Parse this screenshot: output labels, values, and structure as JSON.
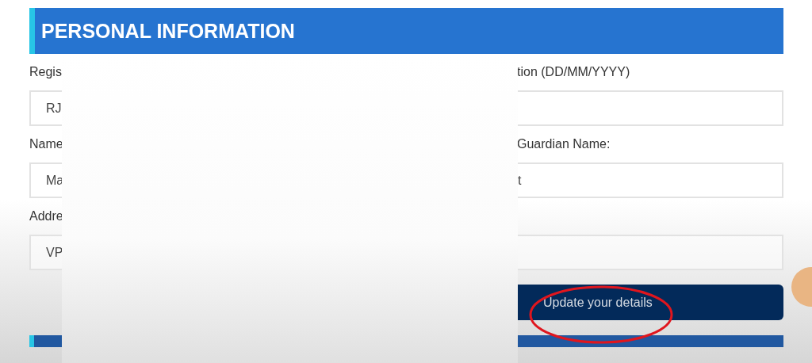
{
  "section": {
    "title": "PERSONAL INFORMATION"
  },
  "fields": [
    {
      "kind": "text",
      "label": "Regis",
      "value": "RJ"
    },
    {
      "kind": "text",
      "label": "tion (DD/MM/YYYY)"
    },
    {
      "kind": "text",
      "label": "Name",
      "value": "Ma"
    },
    {
      "kind": "text",
      "label": "Guardian Name:",
      "value": "t"
    },
    {
      "kind": "text",
      "label": "Addre",
      "value": "VP"
    },
    {
      "kind": "text"
    }
  ],
  "button": {
    "label": "Update your details"
  }
}
